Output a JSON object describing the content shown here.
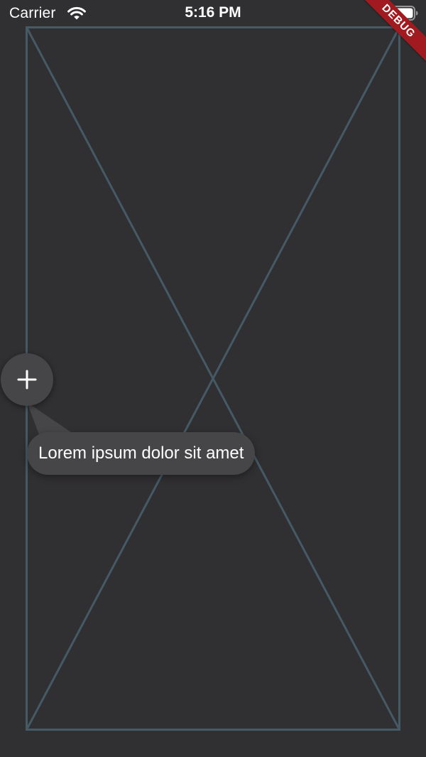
{
  "status_bar": {
    "carrier": "Carrier",
    "time": "5:16 PM",
    "wifi_icon": "wifi-icon",
    "battery_icon": "battery-full-icon"
  },
  "debug_banner": {
    "label": "DEBUG",
    "color": "#a11a1f"
  },
  "placeholder": {
    "stroke_color": "#455a64"
  },
  "fab": {
    "icon": "plus-icon",
    "background": "#464648"
  },
  "tooltip": {
    "text": "Lorem ipsum dolor sit amet"
  },
  "colors": {
    "background": "#302f31",
    "surface": "#464648",
    "text": "#ffffff"
  }
}
